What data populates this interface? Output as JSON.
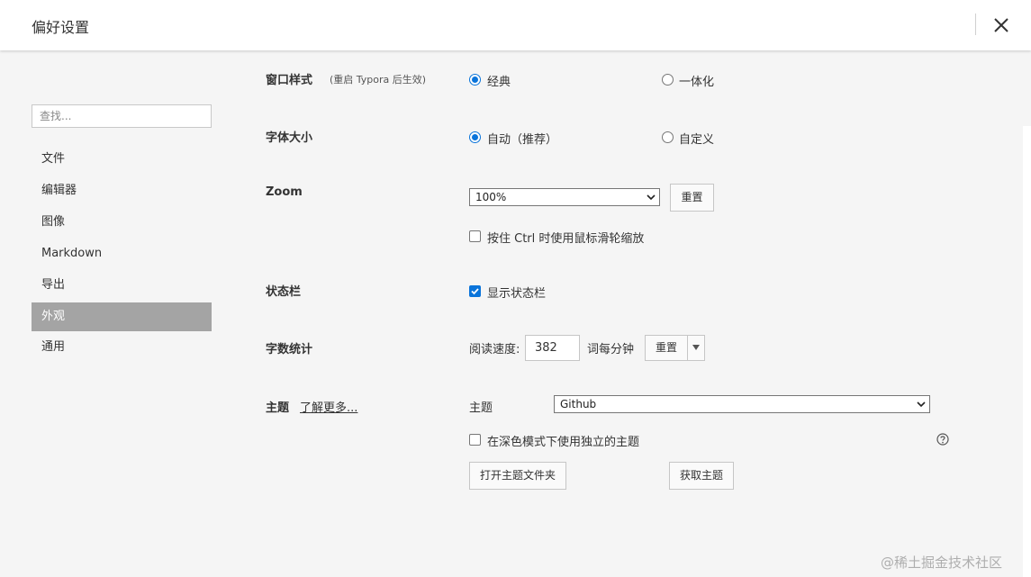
{
  "window": {
    "title": "偏好设置"
  },
  "sidebar": {
    "search_placeholder": "查找...",
    "items": [
      {
        "label": "文件"
      },
      {
        "label": "编辑器"
      },
      {
        "label": "图像"
      },
      {
        "label": "Markdown"
      },
      {
        "label": "导出"
      },
      {
        "label": "外观",
        "active": true
      },
      {
        "label": "通用"
      }
    ]
  },
  "settings": {
    "window_style": {
      "label": "窗口样式",
      "hint": "(重启 Typora 后生效)",
      "options": [
        {
          "label": "经典",
          "checked": true
        },
        {
          "label": "一体化",
          "checked": false
        }
      ]
    },
    "font_size": {
      "label": "字体大小",
      "options": [
        {
          "label": "自动（推荐）",
          "checked": true
        },
        {
          "label": "自定义",
          "checked": false
        }
      ]
    },
    "zoom": {
      "label": "Zoom",
      "value": "100%",
      "reset_label": "重置",
      "ctrl_wheel": {
        "label": "按住 Ctrl 时使用鼠标滑轮缩放",
        "checked": false
      }
    },
    "status_bar": {
      "label": "状态栏",
      "show": {
        "label": "显示状态栏",
        "checked": true
      }
    },
    "word_count": {
      "label": "字数统计",
      "speed_label": "阅读速度:",
      "speed_value": "382",
      "unit": "词每分钟",
      "reset_label": "重置"
    },
    "theme": {
      "label": "主题",
      "learn_more": "了解更多...",
      "select_label": "主题",
      "value": "Github",
      "dark_mode": {
        "label": "在深色模式下使用独立的主题",
        "checked": false
      },
      "open_folder_label": "打开主题文件夹",
      "get_themes_label": "获取主题"
    }
  },
  "watermark": "@稀土掘金技术社区",
  "colors": {
    "accent": "#0a74da",
    "active_nav": "#a4a4a4"
  }
}
